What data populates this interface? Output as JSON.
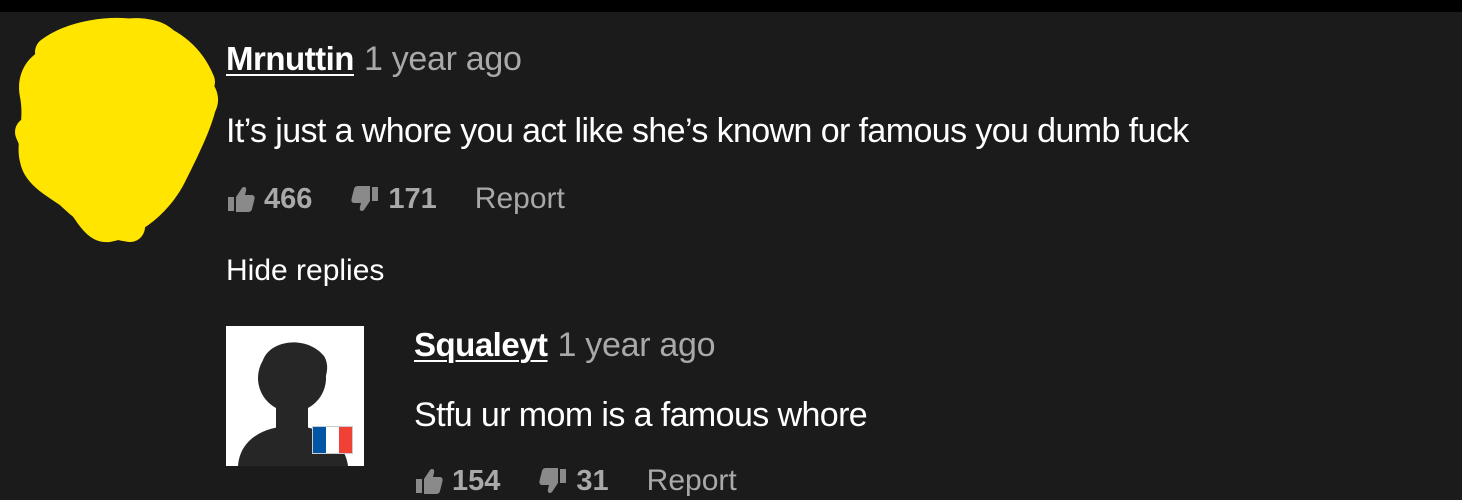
{
  "colors": {
    "background": "#1b1b1b",
    "top_bar": "#000000",
    "text": "#ffffff",
    "muted_text": "#a9a9a9",
    "redaction": "#ffe500",
    "flag_blue": "#0055a4",
    "flag_white": "#ffffff",
    "flag_red": "#ef4135"
  },
  "comment": {
    "username": "Mrnuttin",
    "timestamp": "1 year ago",
    "text": "It’s just a whore you act like she’s known or famous you dumb fuck",
    "likes": "466",
    "dislikes": "171",
    "report_label": "Report",
    "avatar": "redacted-yellow-scribble"
  },
  "hide_replies_label": "Hide replies",
  "reply": {
    "username": "Squaleyt",
    "timestamp": "1 year ago",
    "text": "Stfu ur mom is a famous whore",
    "likes": "154",
    "dislikes": "31",
    "report_label": "Report",
    "avatar": "default-silhouette",
    "country_flag": "france-flag"
  },
  "icons": {
    "like": "thumbs-up-icon",
    "dislike": "thumbs-down-icon"
  }
}
